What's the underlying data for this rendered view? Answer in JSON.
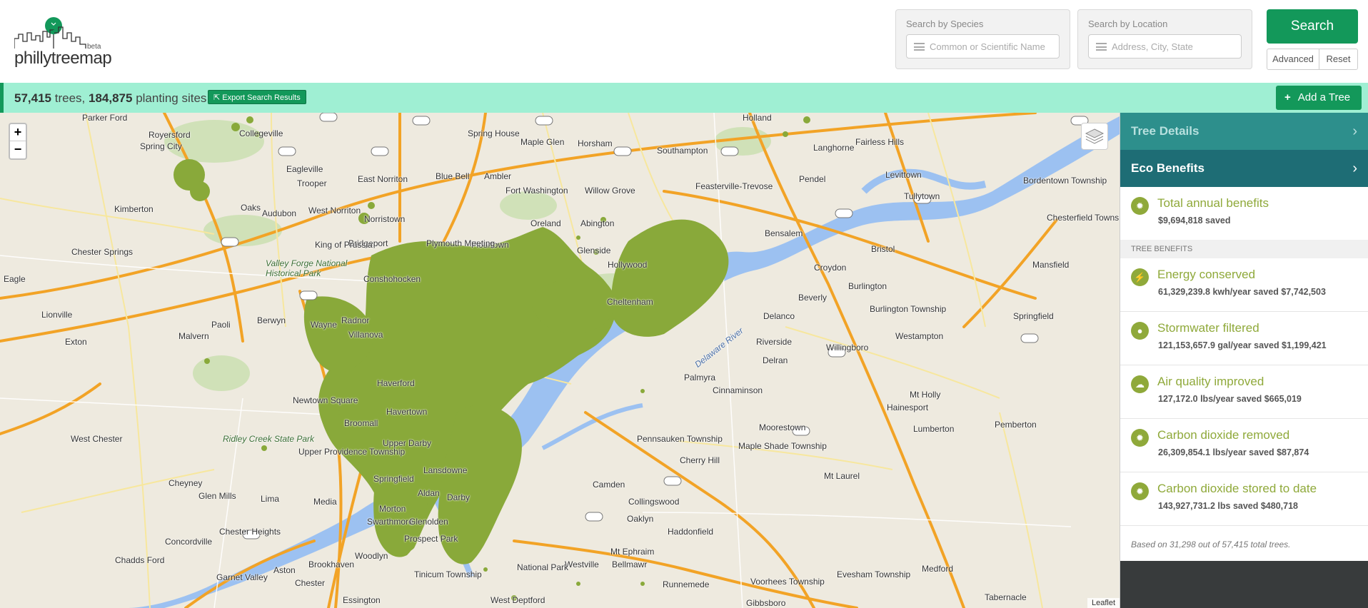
{
  "header": {
    "logo_text": "phillytreemap",
    "logo_beta": "beta",
    "species_search": {
      "label": "Search by Species",
      "placeholder": "Common or Scientific Name"
    },
    "location_search": {
      "label": "Search by Location",
      "placeholder": "Address, City, State"
    },
    "search_label": "Search",
    "advanced_label": "Advanced",
    "reset_label": "Reset"
  },
  "results": {
    "tree_count": "57,415",
    "trees_word": "trees,",
    "site_count": "184,875",
    "sites_word": "planting sites",
    "export_label": "Export Search Results",
    "add_tree_label": "Add a Tree"
  },
  "map": {
    "zoom_in": "+",
    "zoom_out": "−",
    "attribution": "Leaflet",
    "labels": [
      "Parker Ford",
      "Royersford",
      "Spring City",
      "Collegeville",
      "Eagleville",
      "Trooper",
      "East Norriton",
      "Spring House",
      "Maple Glen",
      "Horsham",
      "Southampton",
      "Holland",
      "Langhorne",
      "Fairless Hills",
      "Levittown",
      "Tullytown",
      "Bordentown Township",
      "Pendel",
      "Feasterville-Trevose",
      "Willow Grove",
      "Blue Bell",
      "Ambler",
      "Fort Washington",
      "Oreland",
      "Abington",
      "Glenside",
      "Flourtown",
      "Plymouth Meeting",
      "Norristown",
      "Bridgeport",
      "King of Prussia",
      "West Norriton",
      "Oaks",
      "Audubon",
      "Kimberton",
      "Chester Springs",
      "Eagle",
      "Lionville",
      "Exton",
      "Malvern",
      "Paoli",
      "Berwyn",
      "Wayne",
      "Radnor",
      "Villanova",
      "Haverford",
      "Newtown Square",
      "Broomall",
      "Havertown",
      "Upper Darby",
      "Lansdowne",
      "Springfield",
      "Media",
      "Aldan",
      "Darby",
      "Morton",
      "Swarthmore",
      "Glenolden",
      "Prospect Park",
      "Woodlyn",
      "Brookhaven",
      "Chester",
      "Aston",
      "Garnet Valley",
      "Chadds Ford",
      "Concordville",
      "Chester Heights",
      "Glen Mills",
      "Lima",
      "Cheyney",
      "West Chester",
      "Upper Providence Township",
      "Conshohocken",
      "Hollywood",
      "Cheltenham",
      "Bensalem",
      "Croydon",
      "Bristol",
      "Burlington",
      "Burlington Township",
      "Beverly",
      "Delanco",
      "Riverside",
      "Delran",
      "Willingboro",
      "Westampton",
      "Palmyra",
      "Cinnaminson",
      "Moorestown",
      "Mt Holly",
      "Hainesport",
      "Lumberton",
      "Pemberton",
      "Springfield",
      "Mansfield",
      "Chesterfield Township",
      "Pennsauken Township",
      "Maple Shade Township",
      "Cherry Hill",
      "Mt Laurel",
      "Camden",
      "Collingswood",
      "Oaklyn",
      "Haddonfield",
      "Mt Ephraim",
      "Westville",
      "Bellmawr",
      "Runnemede",
      "Voorhees Township",
      "Evesham Township",
      "Medford",
      "Gibbsboro",
      "Tabernacle",
      "National Park",
      "West Deptford",
      "Tinicum Township",
      "Essington",
      "Valley Forge National Historical Park",
      "Ridley Creek State Park",
      "Delaware River"
    ]
  },
  "sidebar": {
    "tree_details": "Tree Details",
    "eco_benefits": "Eco Benefits",
    "total": {
      "title": "Total annual benefits",
      "value": "$9,694,818 saved"
    },
    "section_label": "TREE BENEFITS",
    "benefits": [
      {
        "title": "Energy conserved",
        "value": "61,329,239.8 kwh/year saved $7,742,503",
        "icon": "bolt-icon"
      },
      {
        "title": "Stormwater filtered",
        "value": "121,153,657.9 gal/year saved $1,199,421",
        "icon": "water-drop-icon"
      },
      {
        "title": "Air quality improved",
        "value": "127,172.0 lbs/year saved $665,019",
        "icon": "cloud-icon"
      },
      {
        "title": "Carbon dioxide removed",
        "value": "26,309,854.1 lbs/year saved $87,874",
        "icon": "sun-icon"
      },
      {
        "title": "Carbon dioxide stored to date",
        "value": "143,927,731.2 lbs saved $480,718",
        "icon": "sun-icon"
      }
    ],
    "footnote": "Based on 31,298 out of 57,415 total trees."
  }
}
